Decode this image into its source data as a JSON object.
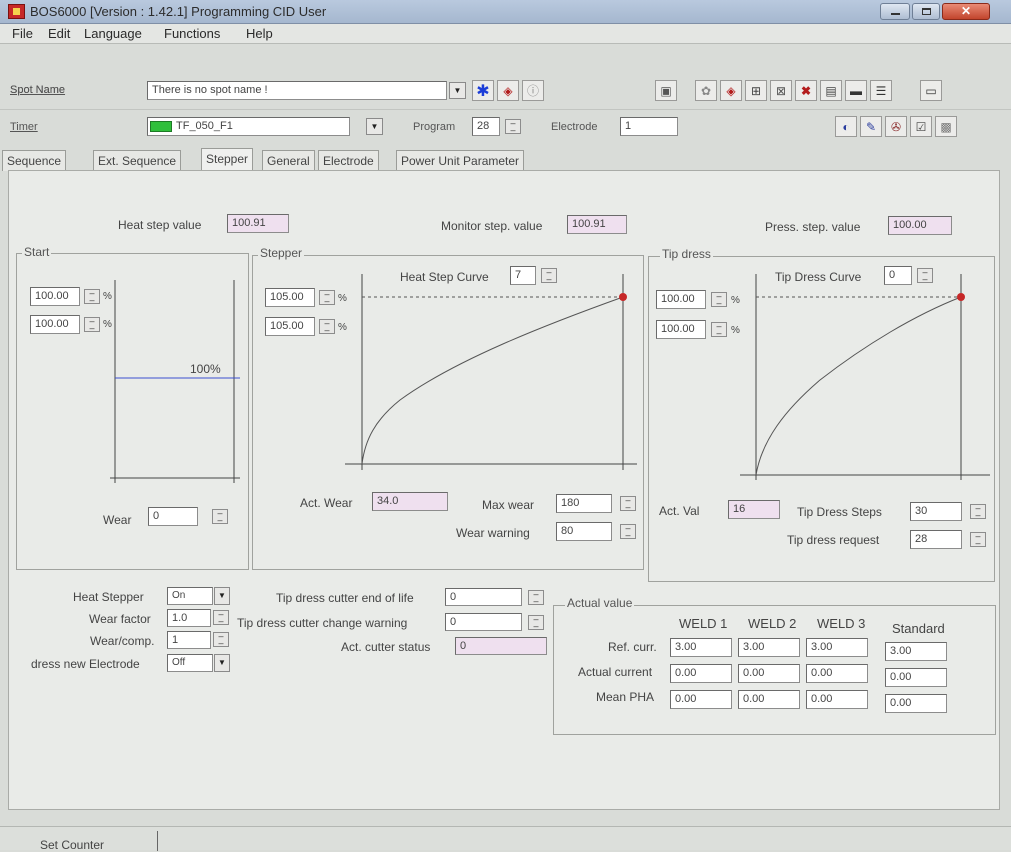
{
  "window": {
    "title": "BOS6000 [Version : 1.42.1] Programming CID User"
  },
  "menu": [
    "File",
    "Edit",
    "Language",
    "Functions",
    "Help"
  ],
  "toolbar": {
    "spot_name_label": "Spot Name",
    "spot_name_value": "There is no spot name !",
    "timer_label": "Timer",
    "timer_value": "TF_050_F1",
    "program_label": "Program",
    "program_value": "28",
    "electrode_label": "Electrode",
    "electrode_value": "1"
  },
  "tabs": [
    "Sequence",
    "Ext. Sequence",
    "Stepper",
    "General",
    "Electrode",
    "Power Unit Parameter"
  ],
  "active_tab": "Stepper",
  "steps": {
    "heat_label": "Heat step value",
    "heat_value": "100.91",
    "monitor_label": "Monitor step. value",
    "monitor_value": "100.91",
    "press_label": "Press. step. value",
    "press_value": "100.00"
  },
  "start": {
    "title": "Start",
    "value1": "100.00",
    "value2": "100.00",
    "unit": "%",
    "line_label": "100%",
    "wear_label": "Wear",
    "wear_value": "0"
  },
  "stepper": {
    "title": "Stepper",
    "curve_label": "Heat Step Curve",
    "curve_value": "7",
    "value1": "105.00",
    "value2": "105.00",
    "unit": "%",
    "act_wear_label": "Act. Wear",
    "act_wear_value": "34.0",
    "max_wear_label": "Max wear",
    "max_wear_value": "180",
    "wear_warning_label": "Wear warning",
    "wear_warning_value": "80"
  },
  "tipdress": {
    "title": "Tip dress",
    "curve_label": "Tip Dress Curve",
    "curve_value": "0",
    "value1": "100.00",
    "value2": "100.00",
    "unit": "%",
    "act_val_label": "Act. Val",
    "act_val_value": "16",
    "steps_label": "Tip Dress Steps",
    "steps_value": "30",
    "request_label": "Tip dress request",
    "request_value": "28"
  },
  "settings": {
    "heat_stepper_label": "Heat Stepper",
    "heat_stepper_value": "On",
    "wear_factor_label": "Wear factor",
    "wear_factor_value": "1.0",
    "wear_comp_label": "Wear/comp.",
    "wear_comp_value": "1",
    "dress_new_label": "dress new Electrode",
    "dress_new_value": "Off"
  },
  "cutter": {
    "end_of_life_label": "Tip dress cutter end of life",
    "end_of_life_value": "0",
    "change_warning_label": "Tip dress cutter change warning",
    "change_warning_value": "0",
    "status_label": "Act. cutter status",
    "status_value": "0"
  },
  "actual": {
    "title": "Actual value",
    "columns": [
      "WELD 1",
      "WELD 2",
      "WELD 3",
      "Standard"
    ],
    "rows": [
      {
        "label": "Ref. curr.",
        "values": [
          "3.00",
          "3.00",
          "3.00",
          "3.00"
        ]
      },
      {
        "label": "Actual current",
        "values": [
          "0.00",
          "0.00",
          "0.00",
          "0.00"
        ]
      },
      {
        "label": "Mean PHA",
        "values": [
          "0.00",
          "0.00",
          "0.00",
          "0.00"
        ]
      }
    ]
  },
  "status": {
    "set_counter": "Set Counter"
  }
}
